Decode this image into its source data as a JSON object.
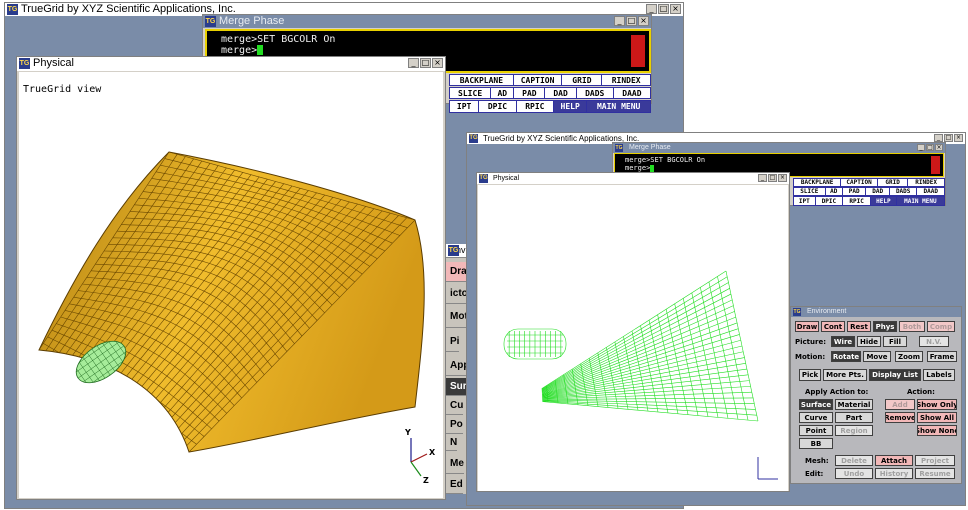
{
  "colors": {
    "title_bar_dark": "#7a8ca8",
    "terminal_border": "#e8d000",
    "menu_border": "#3030a0",
    "surface_fill": "#e8b020",
    "wire_mesh": "#22dd22"
  },
  "main_window": {
    "title": "TrueGrid by XYZ Scientific Applications, Inc."
  },
  "merge_window": {
    "title": "Merge Phase",
    "terminal": {
      "line1": "merge>SET BGCOLR On",
      "line2": "merge>"
    },
    "buttons_row1": [
      "BACKPLANE",
      "CAPTION",
      "GRID",
      "RINDEX"
    ],
    "buttons_row2": [
      "SLICE",
      "AD",
      "PAD",
      "DAD",
      "DADS",
      "DAAD"
    ],
    "buttons_row3": [
      "IPT",
      "DPIC",
      "RPIC",
      "HELP",
      "MAIN MENU"
    ]
  },
  "physical_window": {
    "title": "Physical",
    "view_label": "TrueGrid view",
    "axes": {
      "y": "Y",
      "x": "X",
      "z": "Z"
    }
  },
  "env_stub": {
    "title": "Env",
    "rows": [
      "Dra",
      "icto",
      "Mot:",
      "Pi",
      "App",
      "Sur",
      "Cu",
      "Po",
      "N",
      "Me",
      "Ed"
    ]
  },
  "second_main": {
    "title": "TrueGrid by XYZ Scientific Applications, Inc."
  },
  "second_merge": {
    "title": "Merge Phase",
    "terminal": {
      "line1": "merge>SET BGCOLR On",
      "line2": "merge>"
    },
    "buttons_row1": [
      "BACKPLANE",
      "CAPTION",
      "GRID",
      "RINDEX"
    ],
    "buttons_row2": [
      "SLICE",
      "AD",
      "PAD",
      "DAD",
      "DADS",
      "DAAD"
    ],
    "buttons_row3": [
      "IPT",
      "DPIC",
      "RPIC",
      "HELP",
      "MAIN MENU"
    ]
  },
  "second_physical": {
    "title": "Physical"
  },
  "environment": {
    "title": "Environment",
    "draw_row": [
      "Draw",
      "Cont",
      "Rest",
      "Phys",
      "Both",
      "Comp"
    ],
    "picture_label": "Picture:",
    "picture_buttons": [
      "Wire",
      "Hide",
      "Fill",
      "N.V."
    ],
    "motion_label": "Motion:",
    "motion_buttons": [
      "Rotate",
      "Move",
      "Zoom",
      "Frame"
    ],
    "pick_row": [
      "Pick",
      "More Pts.",
      "Display List",
      "Labels"
    ],
    "apply_label": "Apply Action to:",
    "action_label": "Action:",
    "apply_buttons": [
      "Surface",
      "Material",
      "Curve",
      "Part",
      "Point",
      "Region",
      "BB"
    ],
    "action_buttons": [
      "Add",
      "Show Only",
      "Remove",
      "Show All",
      "Show None"
    ],
    "mesh_label": "Mesh:",
    "mesh_buttons": [
      "Delete",
      "Attach",
      "Project"
    ],
    "edit_label": "Edit:",
    "edit_buttons": [
      "Undo",
      "History",
      "Resume"
    ]
  }
}
